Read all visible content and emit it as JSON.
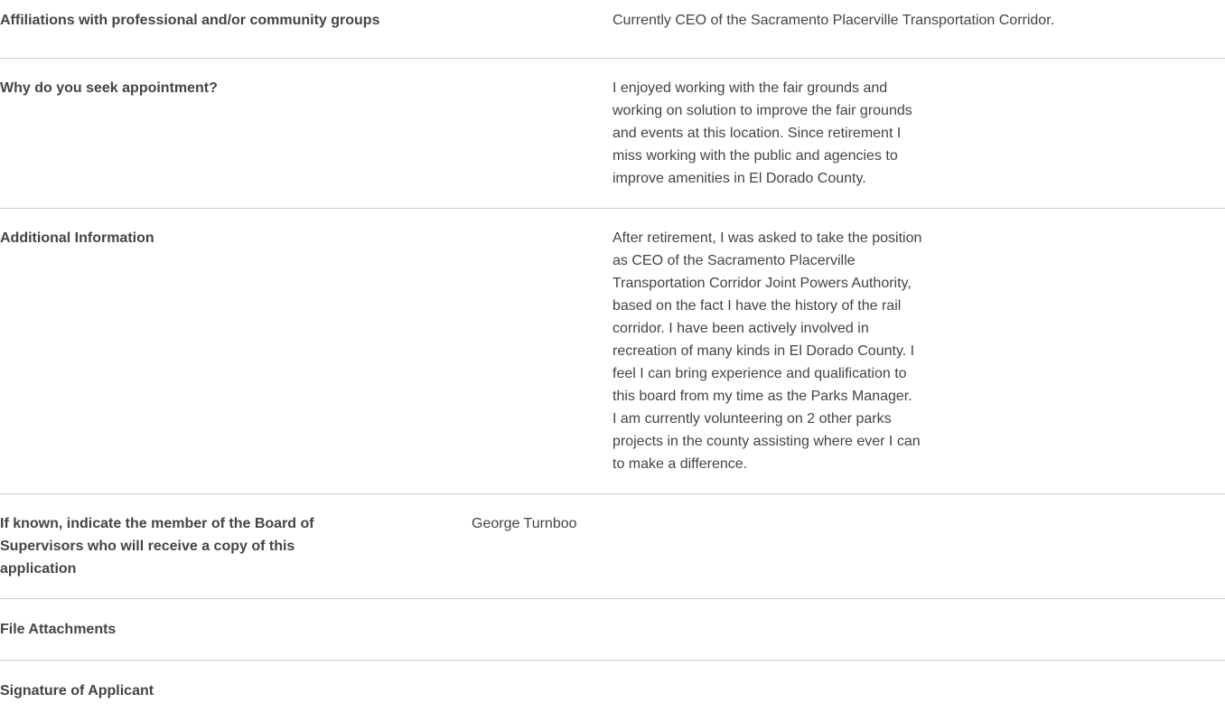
{
  "form": {
    "rows": [
      {
        "label": "Affiliations with professional and/or community groups",
        "value": [
          "Currently CEO of the Sacramento Placerville Transportation Corridor."
        ]
      },
      {
        "label": "Why do you seek appointment?",
        "value": [
          "I enjoyed working with the fair grounds and working on solution to improve the fair grounds and events at this location. Since retirement I miss working with the public and agencies to improve amenities in El Dorado County."
        ]
      },
      {
        "label": "Additional Information",
        "value": [
          "After retirement, I was asked to take the position as CEO of the Sacramento Placerville Transportation Corridor Joint Powers Authority, based on the fact I have the history of the rail corridor. I have been actively involved in recreation of many kinds in El Dorado County. I feel I can bring experience and qualification to this board from my time as the Parks Manager.",
          "I am currently volunteering on 2 other parks projects in the county assisting where ever I can to make a difference."
        ]
      },
      {
        "label": "If known, indicate the member of the Board of Supervisors who will receive a copy of this application",
        "value": [
          "George Turnboo"
        ]
      },
      {
        "label": "File Attachments",
        "value": []
      },
      {
        "label": "Signature of Applicant",
        "value": []
      }
    ]
  }
}
